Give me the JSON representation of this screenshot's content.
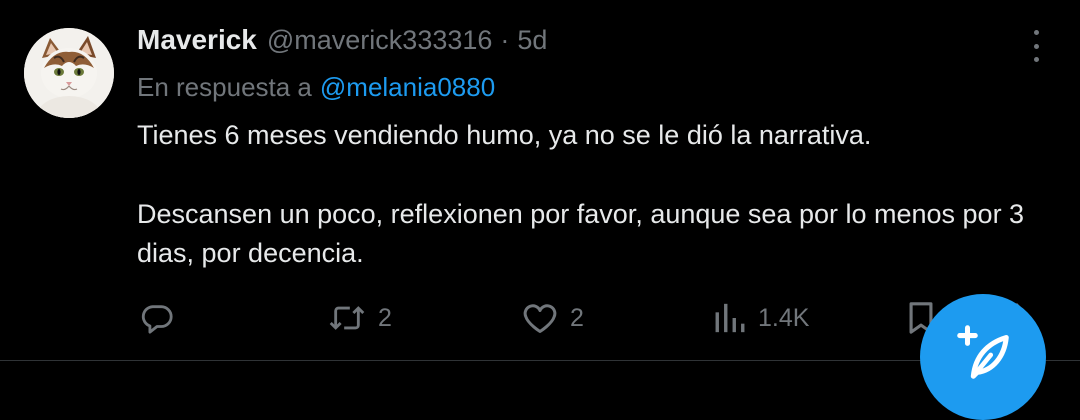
{
  "tweet": {
    "author_name": "Maverick",
    "handle": "@maverick333316",
    "separator": "·",
    "time": "5d",
    "reply_prefix": "En respuesta a",
    "reply_to": "@melania0880",
    "text_line1": "Tienes 6 meses vendiendo humo, ya no se le dió la narrativa.",
    "text_line2": "Descansen un poco, reflexionen por favor, aunque sea por lo menos por 3 dias, por decencia.",
    "avatar_icon": "cat-avatar"
  },
  "actions": {
    "reply_count": "",
    "retweet_count": "2",
    "like_count": "2",
    "views_count": "1.4K"
  },
  "colors": {
    "background": "#000000",
    "primary_text": "#e7e9ea",
    "secondary_text": "#71767b",
    "accent": "#1d9bf0"
  },
  "icons": [
    "more-icon",
    "reply-icon",
    "retweet-icon",
    "like-icon",
    "views-icon",
    "bookmark-icon",
    "share-icon",
    "compose-icon"
  ]
}
